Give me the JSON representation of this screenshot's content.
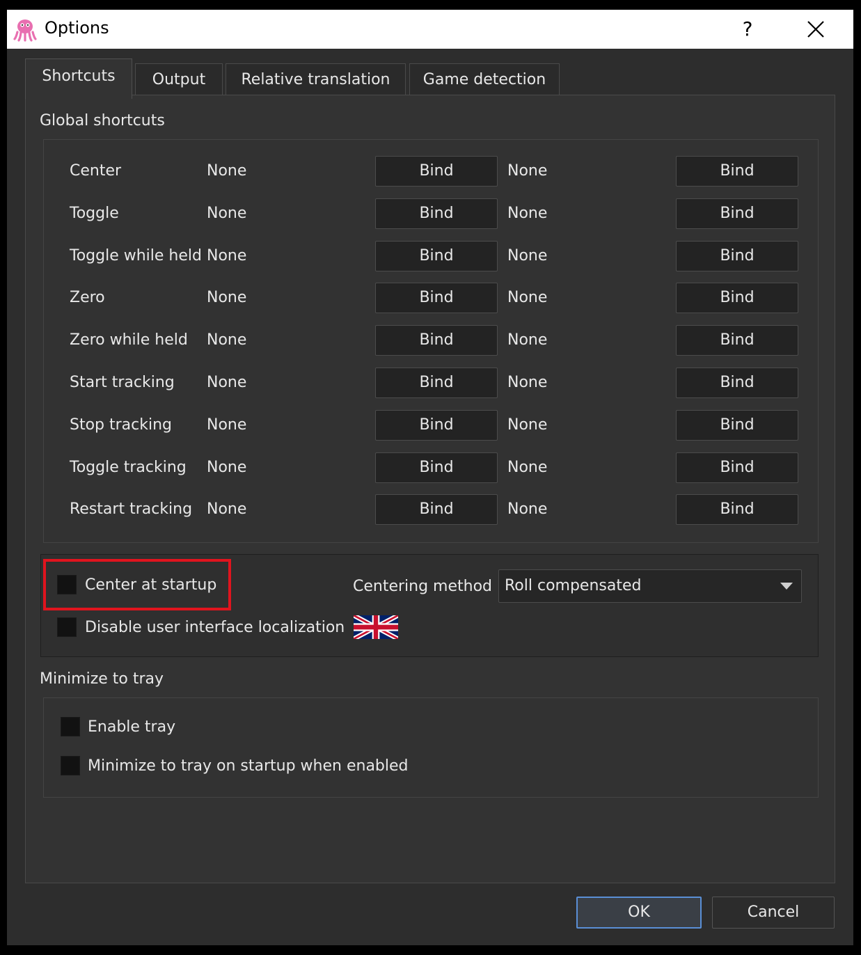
{
  "window": {
    "title": "Options",
    "help_label": "?"
  },
  "tabs": [
    {
      "label": "Shortcuts",
      "active": true
    },
    {
      "label": "Output",
      "active": false
    },
    {
      "label": "Relative translation",
      "active": false
    },
    {
      "label": "Game detection",
      "active": false
    }
  ],
  "global_shortcuts": {
    "title": "Global shortcuts",
    "rows": [
      {
        "label": "Center",
        "key1": "None",
        "bind1": "Bind",
        "key2": "None",
        "bind2": "Bind"
      },
      {
        "label": "Toggle",
        "key1": "None",
        "bind1": "Bind",
        "key2": "None",
        "bind2": "Bind"
      },
      {
        "label": "Toggle while held",
        "key1": "None",
        "bind1": "Bind",
        "key2": "None",
        "bind2": "Bind"
      },
      {
        "label": "Zero",
        "key1": "None",
        "bind1": "Bind",
        "key2": "None",
        "bind2": "Bind"
      },
      {
        "label": "Zero while held",
        "key1": "None",
        "bind1": "Bind",
        "key2": "None",
        "bind2": "Bind"
      },
      {
        "label": "Start tracking",
        "key1": "None",
        "bind1": "Bind",
        "key2": "None",
        "bind2": "Bind"
      },
      {
        "label": "Stop tracking",
        "key1": "None",
        "bind1": "Bind",
        "key2": "None",
        "bind2": "Bind"
      },
      {
        "label": "Toggle tracking",
        "key1": "None",
        "bind1": "Bind",
        "key2": "None",
        "bind2": "Bind"
      },
      {
        "label": "Restart tracking",
        "key1": "None",
        "bind1": "Bind",
        "key2": "None",
        "bind2": "Bind"
      }
    ]
  },
  "general": {
    "center_at_startup": {
      "label": "Center at startup",
      "checked": false
    },
    "disable_localization": {
      "label": "Disable user interface localization",
      "checked": false
    },
    "centering_method": {
      "label": "Centering method",
      "value": "Roll compensated"
    },
    "flag_icon": "uk-flag-icon",
    "highlight_color": "#e0141e"
  },
  "tray": {
    "title": "Minimize to tray",
    "enable_tray": {
      "label": "Enable tray",
      "checked": false
    },
    "minimize_on_startup": {
      "label": "Minimize to tray on startup when enabled",
      "checked": false
    }
  },
  "buttons": {
    "ok": "OK",
    "cancel": "Cancel"
  }
}
